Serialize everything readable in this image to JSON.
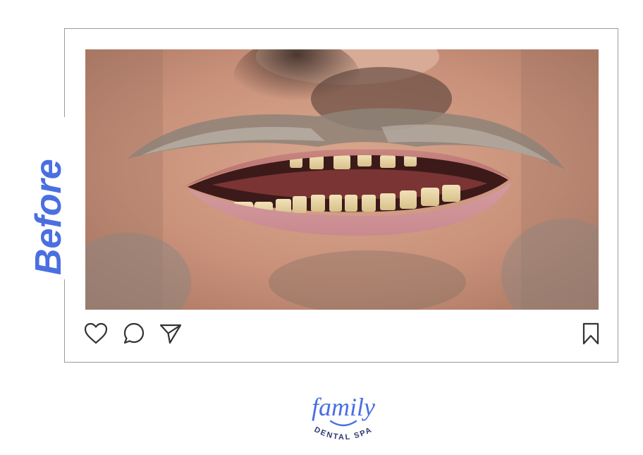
{
  "post": {
    "side_label": "Before",
    "photo_alt": "Before treatment smile",
    "actions": {
      "like_icon": "heart-icon",
      "comment_icon": "comment-bubble-icon",
      "share_icon": "paper-plane-icon",
      "save_icon": "bookmark-icon"
    }
  },
  "brand": {
    "name": "family",
    "subtitle": "DENTAL SPA",
    "color": "#4a6fe0"
  },
  "colors": {
    "accent": "#4a6fe0",
    "frame": "#9a9a9a",
    "icon": "#333333"
  }
}
